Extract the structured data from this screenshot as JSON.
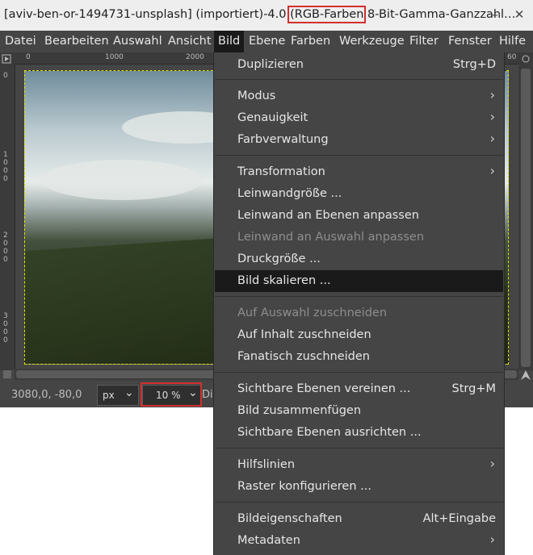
{
  "title": {
    "prefix": "[aviv-ben-or-1494731-unsplash] (importiert)-4.0 ",
    "highlight": "(RGB-Farben",
    "suffix": " 8-Bit-Gamma-Ganzzahl…"
  },
  "window_controls": {
    "minimize": "–",
    "close": "✕"
  },
  "menubar": [
    "Datei",
    "Bearbeiten",
    "Auswahl",
    "Ansicht",
    "Bild",
    "Ebene",
    "Farben",
    "Werkzeuge",
    "Filter",
    "Fenster",
    "Hilfe"
  ],
  "ruler": {
    "h_labels": [
      "0",
      "1000",
      "2000",
      "60"
    ],
    "v_labels": [
      "0",
      "1",
      "0",
      "0",
      "0",
      "2",
      "0",
      "0",
      "0",
      "3",
      "0",
      "0",
      "0"
    ]
  },
  "status": {
    "coords": "3080,0, -80,0",
    "unit": "px",
    "zoom": "10 %",
    "truncated": "Di"
  },
  "bild_menu": [
    {
      "label": "Duplizieren",
      "shortcut": "Strg+D"
    },
    {
      "label": "Modus",
      "submenu": true
    },
    {
      "label": "Genauigkeit",
      "submenu": true
    },
    {
      "label": "Farbverwaltung",
      "submenu": true
    },
    {
      "label": "Transformation",
      "submenu": true
    },
    {
      "label": "Leinwandgröße ..."
    },
    {
      "label": "Leinwand an Ebenen anpassen"
    },
    {
      "label": "Leinwand an Auswahl anpassen",
      "disabled": true
    },
    {
      "label": "Druckgröße ..."
    },
    {
      "label": "Bild skalieren ...",
      "selected": true
    },
    {
      "label": "Auf Auswahl zuschneiden",
      "disabled": true
    },
    {
      "label": "Auf Inhalt zuschneiden"
    },
    {
      "label": "Fanatisch zuschneiden"
    },
    {
      "label": "Sichtbare Ebenen vereinen ...",
      "shortcut": "Strg+M"
    },
    {
      "label": "Bild zusammenfügen"
    },
    {
      "label": "Sichtbare Ebenen ausrichten ..."
    },
    {
      "label": "Hilfslinien",
      "submenu": true
    },
    {
      "label": "Raster konfigurieren ..."
    },
    {
      "label": "Bildeigenschaften",
      "shortcut": "Alt+Eingabe"
    },
    {
      "label": "Metadaten",
      "submenu": true
    }
  ],
  "colors": {
    "highlight": "#d32f2f",
    "menu_bg": "#454545",
    "selected_bg": "#1a1a1a"
  }
}
